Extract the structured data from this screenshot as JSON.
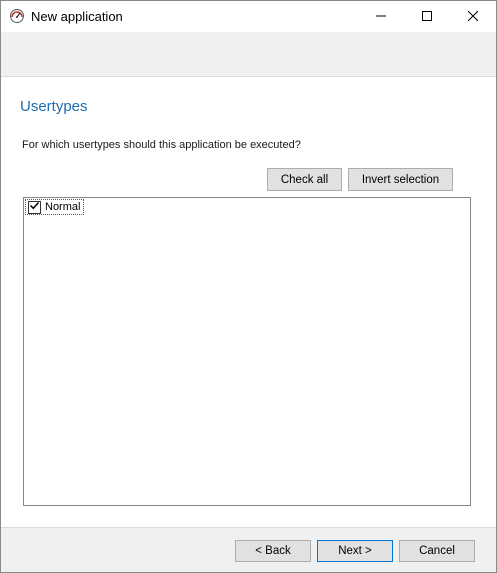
{
  "window": {
    "title": "New application",
    "app_icon": "speedometer-icon",
    "controls": {
      "minimize_icon": "minimize-icon",
      "maximize_icon": "maximize-icon",
      "close_icon": "close-icon"
    }
  },
  "page": {
    "title": "Usertypes",
    "prompt": "For which usertypes should this application be executed?"
  },
  "actions": {
    "check_all_label": "Check all",
    "invert_selection_label": "Invert selection"
  },
  "usertypes": [
    {
      "label": "Normal",
      "checked": true
    }
  ],
  "footer": {
    "back_label": "< Back",
    "next_label": "Next >",
    "cancel_label": "Cancel"
  },
  "colors": {
    "title_accent": "#1e6bb0",
    "default_button_border": "#0078d7"
  }
}
